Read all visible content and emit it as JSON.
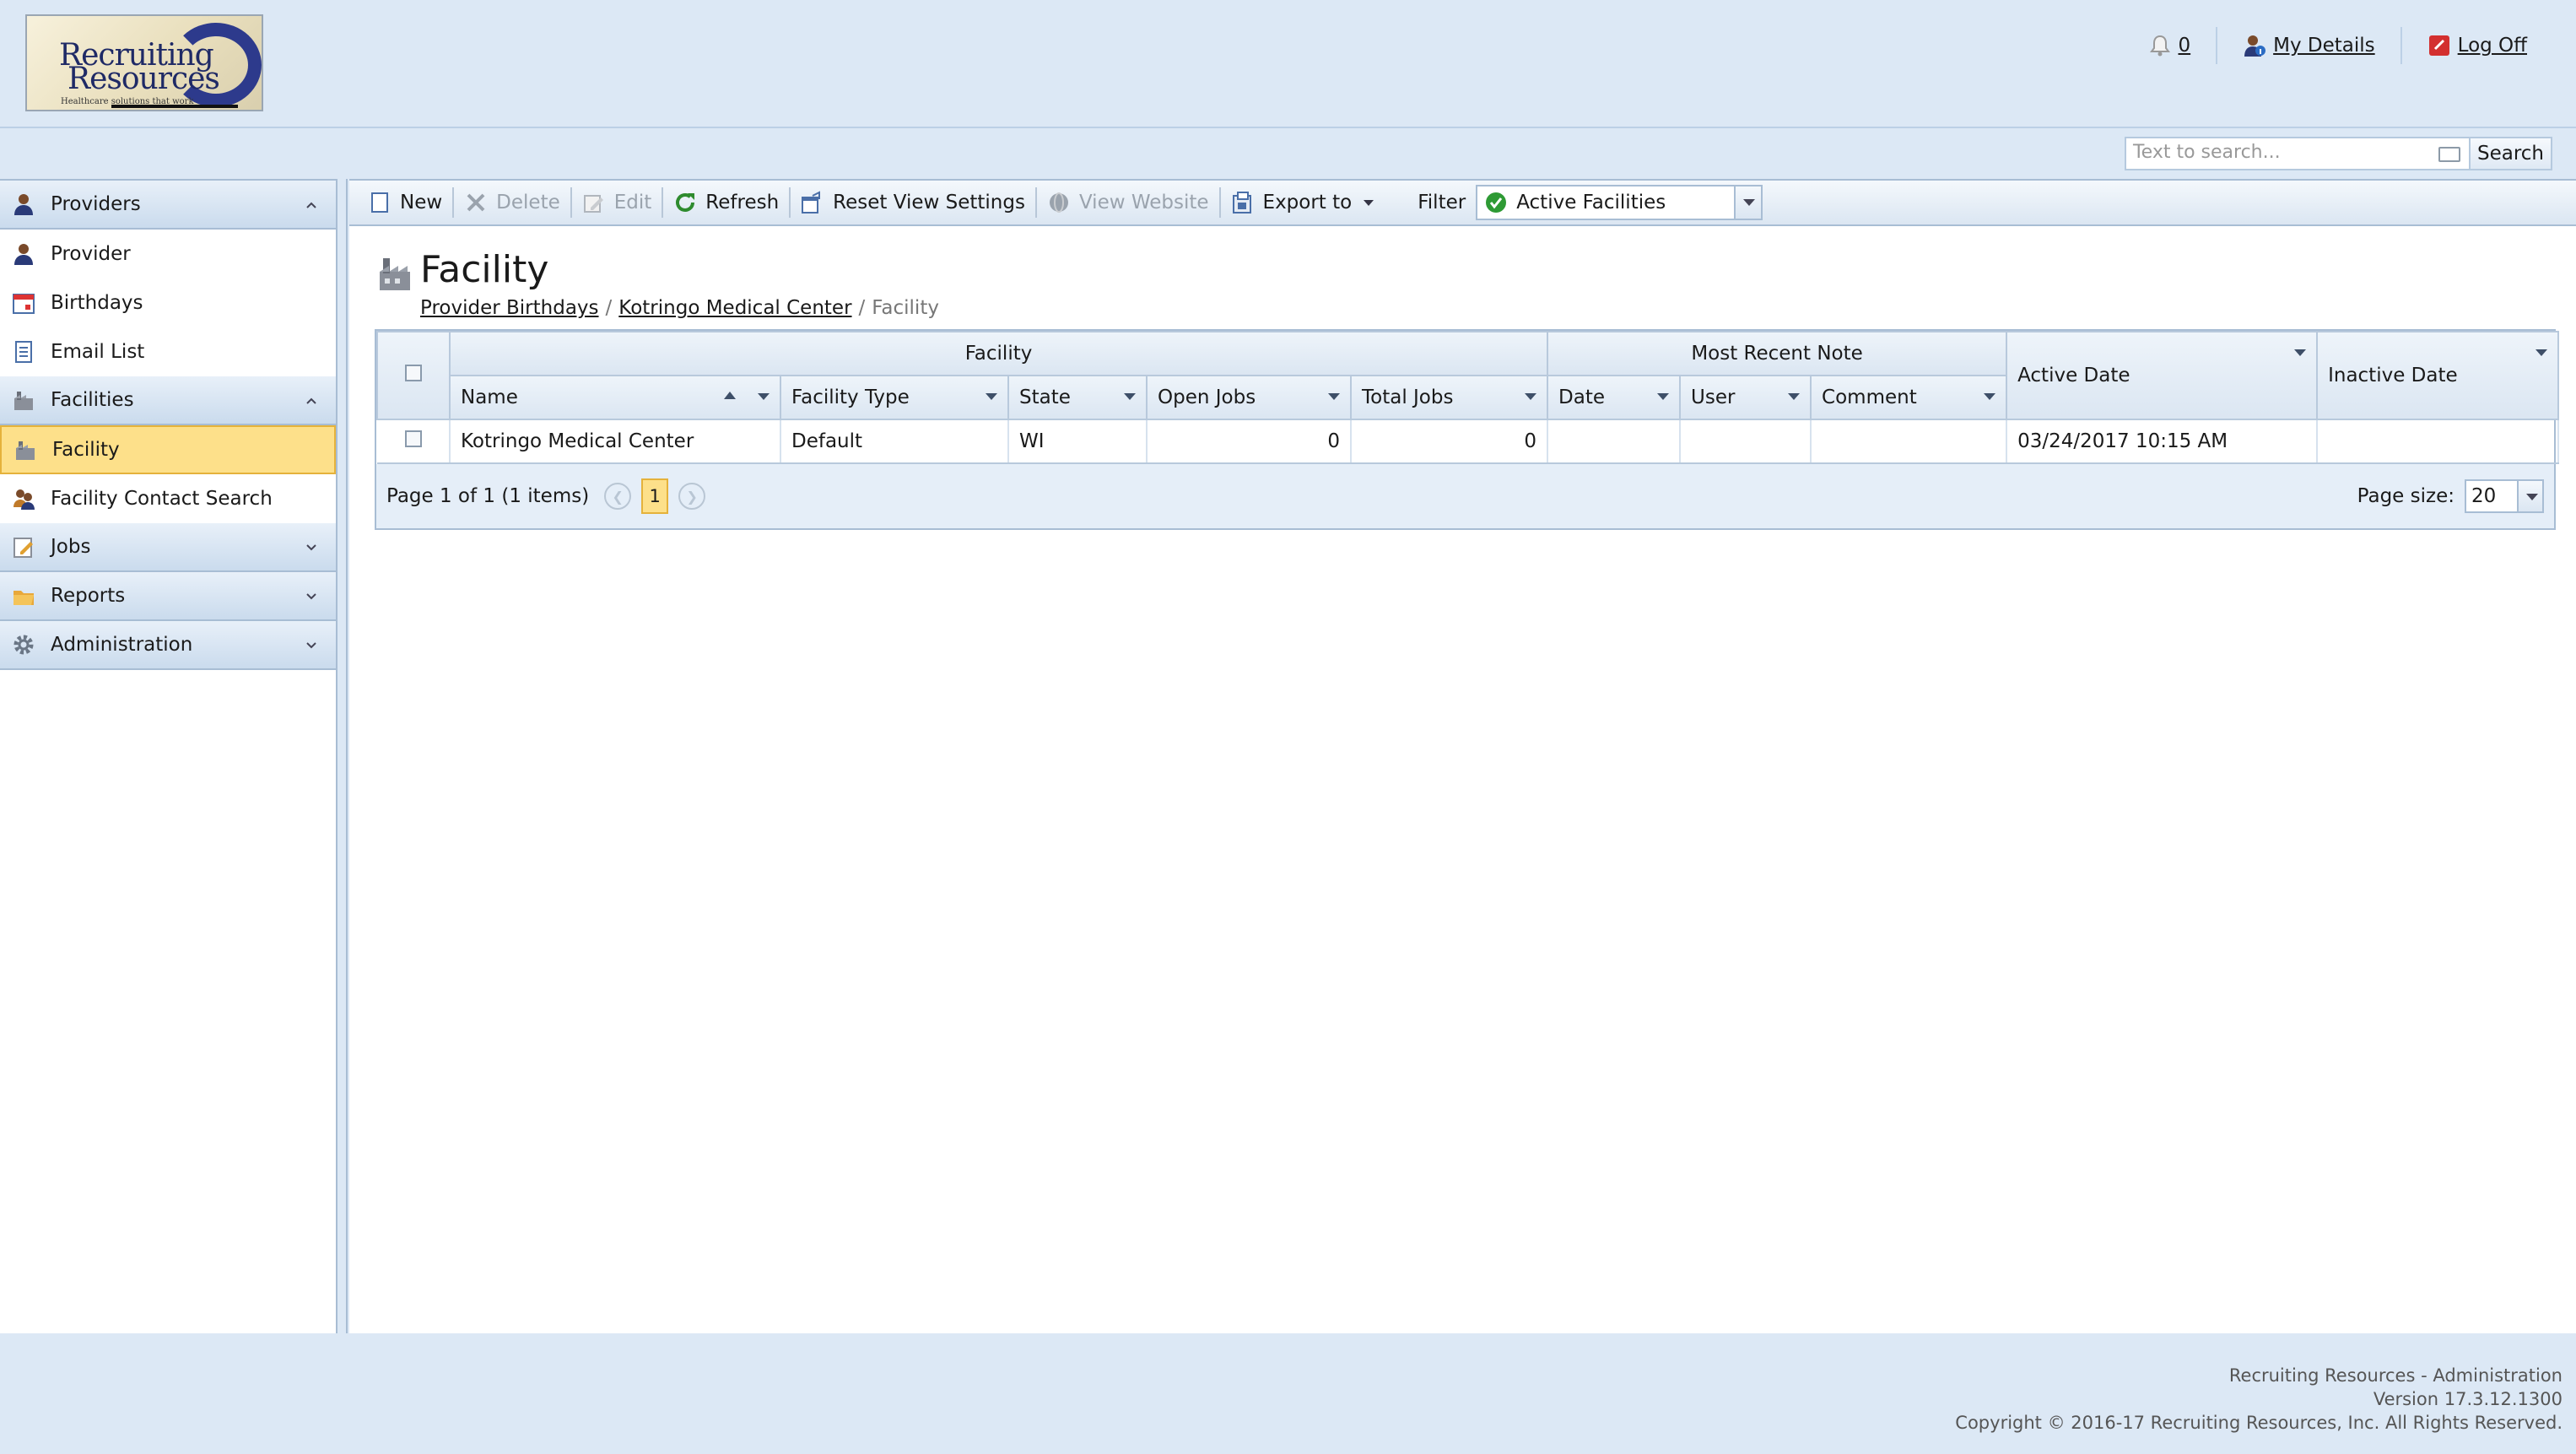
{
  "header": {
    "logo": {
      "line1": "Recruiting",
      "line2": "Resources",
      "tagline": "Healthcare solutions that work"
    },
    "notifications_count": "0",
    "my_details_label": "My Details",
    "log_off_label": "Log Off"
  },
  "search": {
    "placeholder": "Text to search...",
    "button_label": "Search"
  },
  "nav": {
    "groups": [
      {
        "label": "Providers",
        "expanded": true,
        "items": [
          "Provider",
          "Birthdays",
          "Email List"
        ]
      },
      {
        "label": "Facilities",
        "expanded": true,
        "items": [
          "Facility",
          "Facility Contact Search"
        ]
      },
      {
        "label": "Jobs",
        "expanded": false
      },
      {
        "label": "Reports",
        "expanded": false
      },
      {
        "label": "Administration",
        "expanded": false
      }
    ],
    "active_item": "Facility"
  },
  "toolbar": {
    "new_label": "New",
    "delete_label": "Delete",
    "edit_label": "Edit",
    "refresh_label": "Refresh",
    "reset_label": "Reset View Settings",
    "view_website_label": "View Website",
    "export_label": "Export to",
    "filter_label": "Filter",
    "filter_value": "Active Facilities"
  },
  "page": {
    "title": "Facility",
    "breadcrumb": [
      "Provider Birthdays",
      "Kotringo Medical Center",
      "Facility"
    ]
  },
  "grid": {
    "band_headers": {
      "facility": "Facility",
      "most_recent_note": "Most Recent Note"
    },
    "columns": [
      "Name",
      "Facility Type",
      "State",
      "Open Jobs",
      "Total Jobs",
      "Date",
      "User",
      "Comment",
      "Active Date",
      "Inactive Date"
    ],
    "rows": [
      {
        "name": "Kotringo Medical Center",
        "facility_type": "Default",
        "state": "WI",
        "open_jobs": "0",
        "total_jobs": "0",
        "date": "",
        "user": "",
        "comment": "",
        "active_date": "03/24/2017 10:15 AM",
        "inactive_date": ""
      }
    ],
    "pager": {
      "summary": "Page 1 of 1 (1 items)",
      "current_page": "1",
      "page_size_label": "Page size:",
      "page_size": "20"
    }
  },
  "footer": {
    "line1": "Recruiting Resources - Administration",
    "line2": "Version 17.3.12.1300",
    "line3": "Copyright © 2016-17 Recruiting Resources, Inc. All Rights Reserved."
  },
  "colors": {
    "accent_selected": "#fde08a",
    "header_bg": "#dce8f5",
    "border": "#a8bdd4"
  }
}
